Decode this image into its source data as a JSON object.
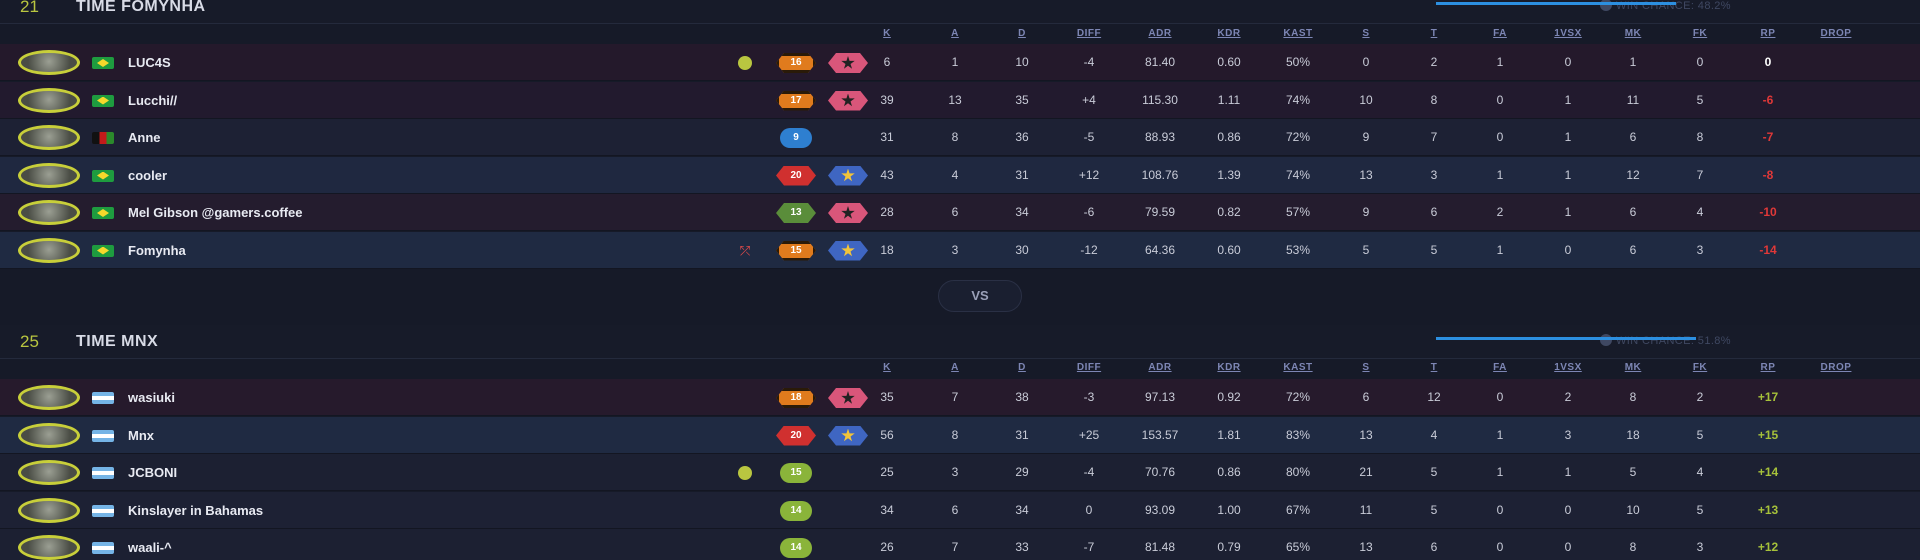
{
  "columns": [
    "K",
    "A",
    "D",
    "DIFF",
    "ADR",
    "KDR",
    "KAST",
    "S",
    "T",
    "FA",
    "1VSX",
    "MK",
    "FK",
    "RP",
    "DROP"
  ],
  "team1": {
    "score": "21",
    "name": "TIME FOMYNHA",
    "win_chance": "WIN CHANCE: 48.2%",
    "players": [
      {
        "flag": "br",
        "name": "LUC4S",
        "extra": "captain",
        "level": "16",
        "level_style": "lv-orange",
        "rank": "rk-pink",
        "stats": [
          "6",
          "1",
          "10",
          "-4",
          "81.40",
          "0.60",
          "50%",
          "0",
          "2",
          "1",
          "0",
          "1",
          "0",
          "0"
        ],
        "rp_style": "rp-zero"
      },
      {
        "flag": "br",
        "name": "Lucchi//",
        "extra": "",
        "level": "17",
        "level_style": "lv-orange",
        "rank": "rk-pink",
        "stats": [
          "39",
          "13",
          "35",
          "+4",
          "115.30",
          "1.11",
          "74%",
          "10",
          "8",
          "0",
          "1",
          "11",
          "5",
          "-6"
        ],
        "rp_style": "rp-neg"
      },
      {
        "flag": "af",
        "name": "Anne",
        "extra": "",
        "level": "9",
        "level_style": "lv-blue",
        "rank": "",
        "stats": [
          "31",
          "8",
          "36",
          "-5",
          "88.93",
          "0.86",
          "72%",
          "9",
          "7",
          "0",
          "1",
          "6",
          "8",
          "-7"
        ],
        "rp_style": "rp-neg"
      },
      {
        "flag": "br",
        "name": "cooler",
        "extra": "",
        "level": "20",
        "level_style": "lv-red",
        "rank": "rk-blue",
        "stats": [
          "43",
          "4",
          "31",
          "+12",
          "108.76",
          "1.39",
          "74%",
          "13",
          "3",
          "1",
          "1",
          "12",
          "7",
          "-8"
        ],
        "rp_style": "rp-neg"
      },
      {
        "flag": "br",
        "name": "Mel Gibson @gamers.coffee",
        "extra": "",
        "level": "13",
        "level_style": "lv-green",
        "rank": "rk-pink",
        "stats": [
          "28",
          "6",
          "34",
          "-6",
          "79.59",
          "0.82",
          "57%",
          "9",
          "6",
          "2",
          "1",
          "6",
          "4",
          "-10"
        ],
        "rp_style": "rp-neg"
      },
      {
        "flag": "br",
        "name": "Fomynha",
        "extra": "runner",
        "level": "15",
        "level_style": "lv-orange",
        "rank": "rk-blue",
        "stats": [
          "18",
          "3",
          "30",
          "-12",
          "64.36",
          "0.60",
          "53%",
          "5",
          "5",
          "1",
          "0",
          "6",
          "3",
          "-14"
        ],
        "rp_style": "rp-neg"
      }
    ]
  },
  "vs_label": "VS",
  "team2": {
    "score": "25",
    "name": "TIME MNX",
    "win_chance": "WIN CHANCE: 51.8%",
    "players": [
      {
        "flag": "ar",
        "name": "wasiuki",
        "extra": "",
        "level": "18",
        "level_style": "lv-orange",
        "rank": "rk-pink",
        "stats": [
          "35",
          "7",
          "38",
          "-3",
          "97.13",
          "0.92",
          "72%",
          "6",
          "12",
          "0",
          "2",
          "8",
          "2",
          "+17"
        ],
        "rp_style": "rp-pos"
      },
      {
        "flag": "ar",
        "name": "Mnx",
        "extra": "",
        "level": "20",
        "level_style": "lv-red",
        "rank": "rk-blue",
        "stats": [
          "56",
          "8",
          "31",
          "+25",
          "153.57",
          "1.81",
          "83%",
          "13",
          "4",
          "1",
          "3",
          "18",
          "5",
          "+15"
        ],
        "rp_style": "rp-pos"
      },
      {
        "flag": "ar",
        "name": "JCBONI",
        "extra": "captain",
        "level": "15",
        "level_style": "lv-lime",
        "rank": "",
        "stats": [
          "25",
          "3",
          "29",
          "-4",
          "70.76",
          "0.86",
          "80%",
          "21",
          "5",
          "1",
          "1",
          "5",
          "4",
          "+14"
        ],
        "rp_style": "rp-pos"
      },
      {
        "flag": "ar",
        "name": "Kinslayer in Bahamas",
        "extra": "",
        "level": "14",
        "level_style": "lv-lime",
        "rank": "",
        "stats": [
          "34",
          "6",
          "34",
          "0",
          "93.09",
          "1.00",
          "67%",
          "11",
          "5",
          "0",
          "0",
          "10",
          "5",
          "+13"
        ],
        "rp_style": "rp-pos"
      },
      {
        "flag": "ar",
        "name": "waali-^",
        "extra": "",
        "level": "14",
        "level_style": "lv-lime",
        "rank": "",
        "stats": [
          "26",
          "7",
          "33",
          "-7",
          "81.48",
          "0.79",
          "65%",
          "13",
          "6",
          "0",
          "0",
          "8",
          "3",
          "+12"
        ],
        "rp_style": "rp-pos"
      }
    ]
  }
}
